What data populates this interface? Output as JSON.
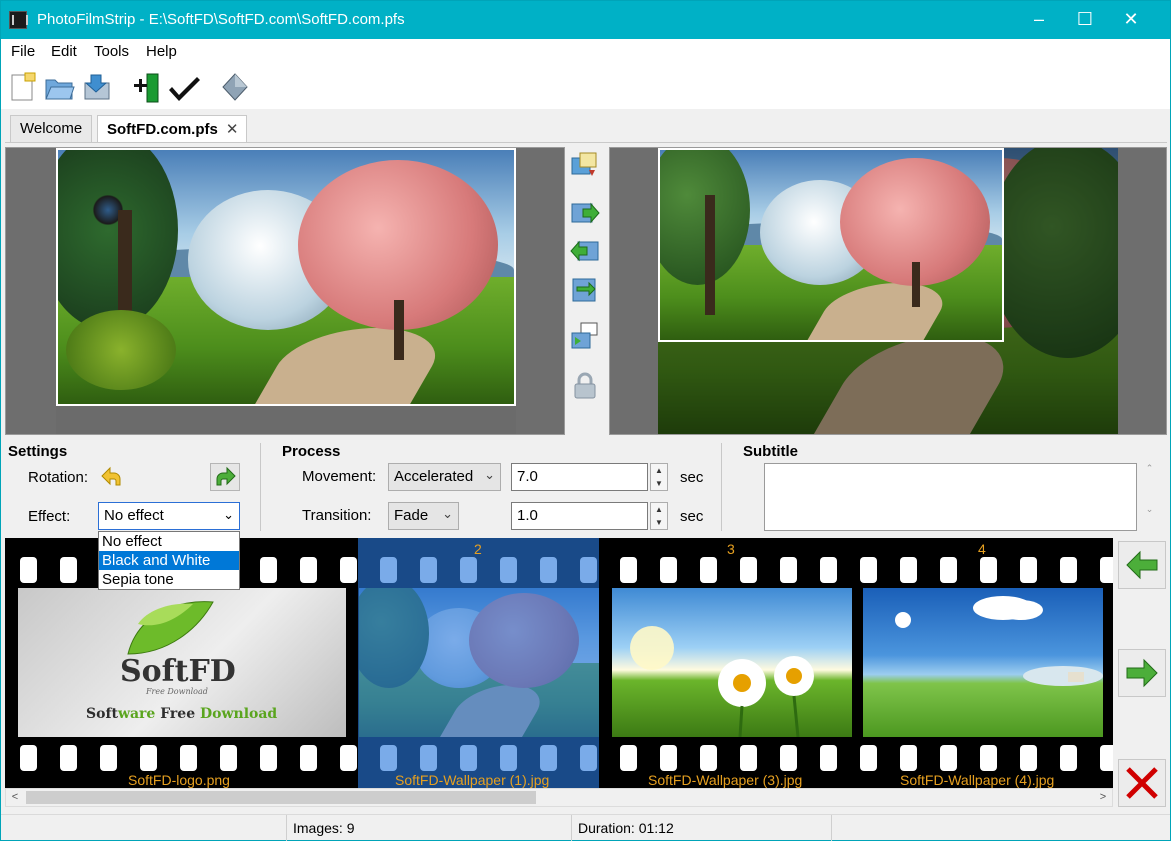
{
  "window": {
    "title": "PhotoFilmStrip - E:\\SoftFD\\SoftFD.com\\SoftFD.com.pfs",
    "minimize": "–",
    "maximize": "☐",
    "close": "✕"
  },
  "menu": [
    "File",
    "Edit",
    "Tools",
    "Help"
  ],
  "toolbar": [
    {
      "name": "new-project-icon"
    },
    {
      "name": "open-folder-icon"
    },
    {
      "name": "save-icon"
    },
    {
      "name": "import-pictures-icon"
    },
    {
      "name": "render-check-icon"
    },
    {
      "name": "diamond-icon"
    }
  ],
  "tabs": [
    {
      "label": "Welcome",
      "active": false
    },
    {
      "label": "SoftFD.com.pfs",
      "active": true,
      "close": "✕"
    }
  ],
  "settings": {
    "title": "Settings",
    "rotation_label": "Rotation:",
    "effect_label": "Effect:",
    "effect_value": "No effect",
    "effect_options": [
      "No effect",
      "Black and White",
      "Sepia tone"
    ],
    "highlighted_option": "Black and White"
  },
  "process": {
    "title": "Process",
    "movement_label": "Movement:",
    "movement_value": "Accelerated",
    "movement_duration": "7.0",
    "transition_label": "Transition:",
    "transition_value": "Fade",
    "transition_duration": "1.0",
    "unit": "sec"
  },
  "subtitle": {
    "title": "Subtitle",
    "text": ""
  },
  "filmstrip": {
    "frames": [
      {
        "number": "",
        "caption": "SoftFD-logo.png",
        "selected": false
      },
      {
        "number": "2",
        "caption": "SoftFD-Wallpaper (1).jpg",
        "selected": true
      },
      {
        "number": "3",
        "caption": "SoftFD-Wallpaper (3).jpg",
        "selected": false
      },
      {
        "number": "4",
        "caption": "SoftFD-Wallpaper (4).jpg",
        "selected": false
      }
    ],
    "logo_text": "SoftFD",
    "logo_tagline": "Free Download",
    "logo_slogan_parts": [
      "Soft",
      "ware ",
      "Free ",
      "Download"
    ]
  },
  "status": {
    "images": "Images: 9",
    "duration": "Duration: 01:12"
  },
  "colors": {
    "titlebar": "#00b1c6",
    "selection": "#0078d7",
    "caption": "#e6a020",
    "delete": "#d00000",
    "arrow_green": "#4cae3a"
  }
}
